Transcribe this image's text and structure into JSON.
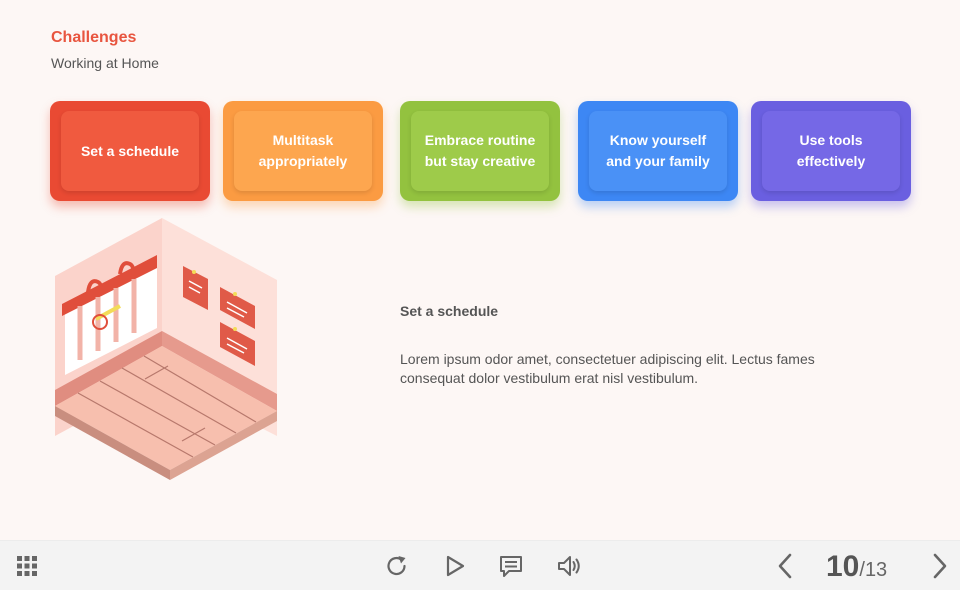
{
  "header": {
    "title": "Challenges",
    "subtitle": "Working at Home"
  },
  "cards": [
    {
      "label": "Set a schedule",
      "color": "#e94a33"
    },
    {
      "label": "Multitask\nappropriately",
      "color": "#fb9b42"
    },
    {
      "label": "Embrace routine\nbut stay creative",
      "color": "#93c23f"
    },
    {
      "label": "Know yourself\nand your family",
      "color": "#3d87f4"
    },
    {
      "label": "Use tools\neffectively",
      "color": "#6a5fe0"
    }
  ],
  "detail": {
    "title": "Set a schedule",
    "body": "Lorem ipsum odor amet, consectetuer adipiscing elit. Lectus fames consequat dolor vestibulum erat nisl vestibulum."
  },
  "footer": {
    "icons": [
      "grid-menu-icon",
      "replay-icon",
      "play-icon",
      "comment-icon",
      "volume-icon",
      "chevron-left-icon",
      "chevron-right-icon"
    ],
    "page_current": "10",
    "page_separator": "/",
    "page_total": "13"
  }
}
